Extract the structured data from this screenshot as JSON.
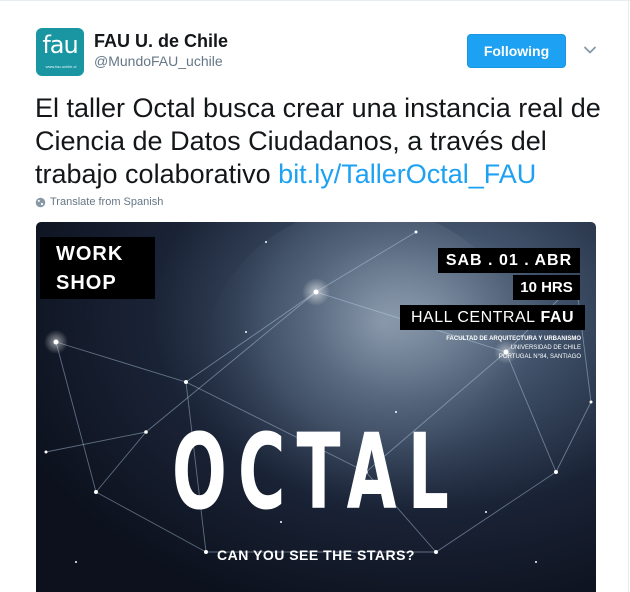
{
  "account": {
    "avatar_text": "fau",
    "avatar_url": "www.fau.uchile.cl",
    "name": "FAU U. de Chile",
    "handle": "@MundoFAU_uchile",
    "follow_label": "Following"
  },
  "tweet": {
    "text": "El taller Octal busca crear una instancia real de Ciencia de Datos Ciudadanos, a través del trabajo colaborativo",
    "link": "bit.ly/TallerOctal_FAU",
    "translate_label": "Translate from Spanish"
  },
  "poster": {
    "work_line1": "WORK",
    "work_line2": "SHOP",
    "date": "SAB . 01 . ABR",
    "time": "10 HRS",
    "hall": "HALL CENTRAL",
    "hall_bold": "FAU",
    "faculty": "FACULTAD DE ARQUITECTURA Y URBANISMO",
    "university": "UNIVERSIDAD DE CHILE",
    "address": "PORTUGAL N°84, SANTIAGO",
    "title": "OCTAL",
    "tagline": "CAN YOU SEE THE STARS?"
  },
  "colors": {
    "accent": "#1da1f2",
    "avatar_bg": "#1a96a2",
    "text": "#14171a",
    "muted": "#657786"
  }
}
